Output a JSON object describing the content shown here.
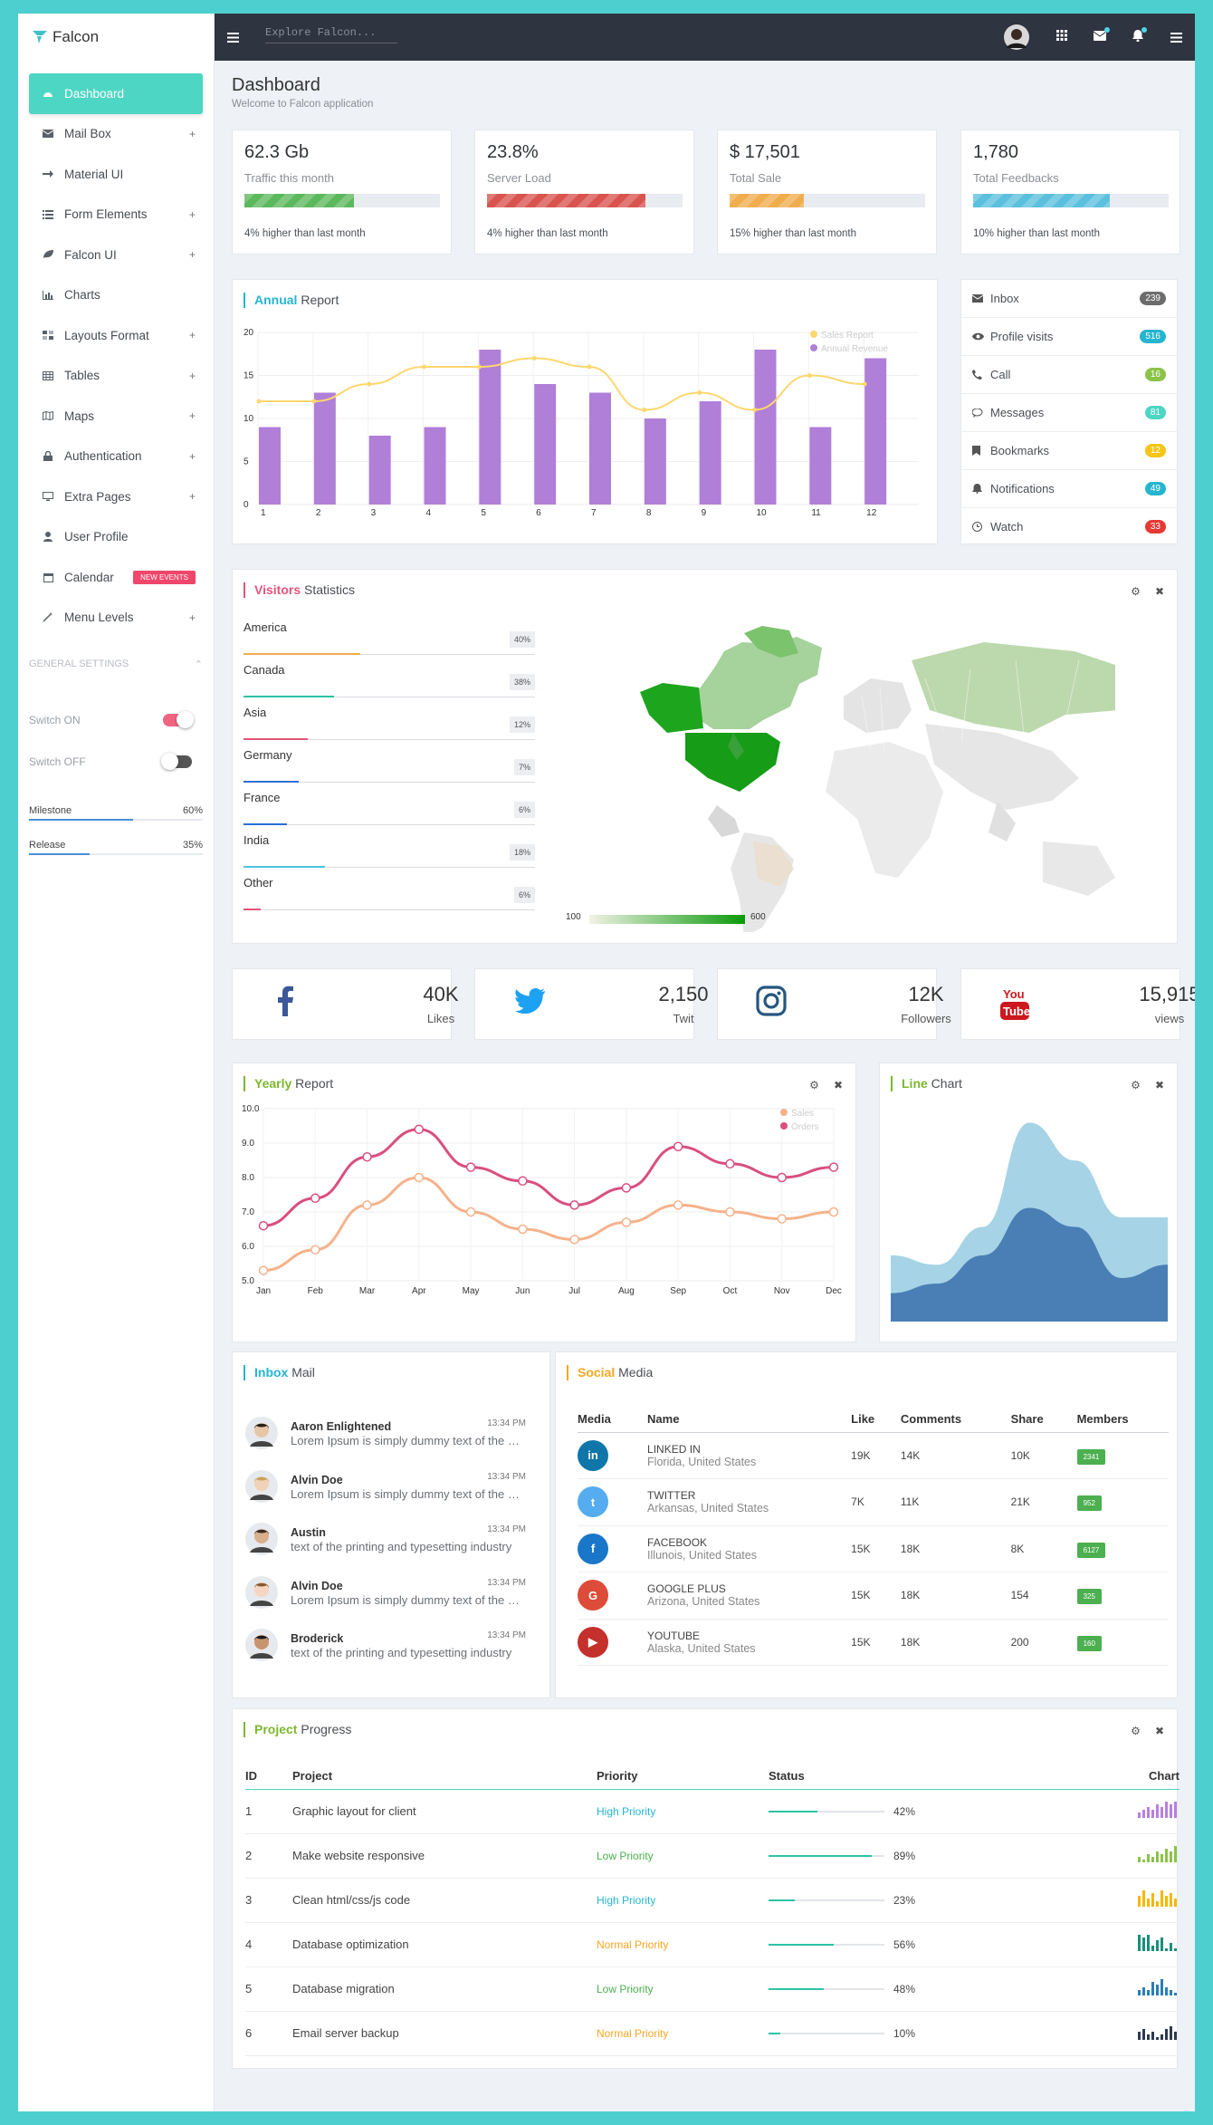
{
  "app": {
    "name": "Falcon"
  },
  "sidebar": {
    "items": [
      {
        "label": "Dashboard",
        "icon": "dashboard-icon",
        "plus": false,
        "active": true
      },
      {
        "label": "Mail Box",
        "icon": "envelope-icon",
        "plus": true
      },
      {
        "label": "Material UI",
        "icon": "arrow-right-icon",
        "plus": false
      },
      {
        "label": "Form Elements",
        "icon": "list-icon",
        "plus": true
      },
      {
        "label": "Falcon UI",
        "icon": "leaf-icon",
        "plus": true
      },
      {
        "label": "Charts",
        "icon": "bar-chart-icon",
        "plus": false
      },
      {
        "label": "Layouts Format",
        "icon": "layout-icon",
        "plus": true
      },
      {
        "label": "Tables",
        "icon": "table-icon",
        "plus": true
      },
      {
        "label": "Maps",
        "icon": "map-icon",
        "plus": true
      },
      {
        "label": "Authentication",
        "icon": "lock-icon",
        "plus": true
      },
      {
        "label": "Extra Pages",
        "icon": "monitor-icon",
        "plus": true
      },
      {
        "label": "User Profile",
        "icon": "user-icon",
        "plus": false
      },
      {
        "label": "Calendar",
        "icon": "calendar-icon",
        "plus": false,
        "badge": "NEW EVENTS"
      },
      {
        "label": "Menu Levels",
        "icon": "magic-icon",
        "plus": true
      }
    ],
    "general_settings": "GENERAL SETTINGS",
    "switch_on": "Switch ON",
    "switch_off": "Switch OFF",
    "milestone": {
      "label": "Milestone",
      "value": "60%",
      "fraction": 0.6
    },
    "release": {
      "label": "Release",
      "value": "35%",
      "fraction": 0.35
    }
  },
  "topbar": {
    "search_placeholder": "Explore Falcon..."
  },
  "page": {
    "title": "Dashboard",
    "subtitle": "Welcome to Falcon application"
  },
  "stats": [
    {
      "value": "62.3 Gb",
      "label": "Traffic this month",
      "note": "4% higher than last month",
      "fraction": 0.56,
      "color": "#5cb85c"
    },
    {
      "value": "23.8%",
      "label": "Server Load",
      "note": "4% higher than last month",
      "fraction": 0.81,
      "color": "#d9534f"
    },
    {
      "value": "$ 17,501",
      "label": "Total Sale",
      "note": "15% higher than last month",
      "fraction": 0.38,
      "color": "#f0ad4e"
    },
    {
      "value": "1,780",
      "label": "Total Feedbacks",
      "note": "10% higher than last month",
      "fraction": 0.7,
      "color": "#5bc0de"
    }
  ],
  "annual": {
    "title_strong": "Annual",
    "title_rest": " Report"
  },
  "inbox_list": [
    {
      "label": "Inbox",
      "icon": "envelope-icon",
      "count": "239",
      "color": "#6c6c6c"
    },
    {
      "label": "Profile visits",
      "icon": "eye-icon",
      "count": "516",
      "color": "#26b5cf"
    },
    {
      "label": "Call",
      "icon": "phone-icon",
      "count": "16",
      "color": "#8bc34a"
    },
    {
      "label": "Messages",
      "icon": "comments-icon",
      "count": "81",
      "color": "#4ed6c4"
    },
    {
      "label": "Bookmarks",
      "icon": "bookmark-icon",
      "count": "12",
      "color": "#f5c518"
    },
    {
      "label": "Notifications",
      "icon": "bell-icon",
      "count": "49",
      "color": "#26b5cf"
    },
    {
      "label": "Watch",
      "icon": "clock-icon",
      "count": "33",
      "color": "#e53935"
    }
  ],
  "visitors": {
    "title_strong": "Visitors",
    "title_rest": " Statistics",
    "rows": [
      {
        "country": "America",
        "value": "40%",
        "fraction": 0.4,
        "color": "#f0ad4e"
      },
      {
        "country": "Canada",
        "value": "38%",
        "fraction": 0.31,
        "color": "#2cc3a6"
      },
      {
        "country": "Asia",
        "value": "12%",
        "fraction": 0.22,
        "color": "#e5547a"
      },
      {
        "country": "Germany",
        "value": "7%",
        "fraction": 0.19,
        "color": "#2a6fd6"
      },
      {
        "country": "France",
        "value": "6%",
        "fraction": 0.15,
        "color": "#2a6fd6"
      },
      {
        "country": "India",
        "value": "18%",
        "fraction": 0.28,
        "color": "#4ec3e0"
      },
      {
        "country": "Other",
        "value": "6%",
        "fraction": 0.06,
        "color": "#e5547a"
      }
    ],
    "scale_min": "100",
    "scale_max": "600"
  },
  "social": [
    {
      "icon": "facebook-icon",
      "value": "40K",
      "label": "Likes"
    },
    {
      "icon": "twitter-icon",
      "value": "2,150",
      "label": "Twit"
    },
    {
      "icon": "instagram-icon",
      "value": "12K",
      "label": "Followers"
    },
    {
      "icon": "youtube-icon",
      "value": "15,915",
      "label": "views"
    }
  ],
  "yearly": {
    "title_strong": "Yearly",
    "title_rest": " Report"
  },
  "linechart": {
    "title_strong": "Line",
    "title_rest": " Chart"
  },
  "chart_data": [
    {
      "type": "bar",
      "categories": [
        "1",
        "2",
        "3",
        "4",
        "5",
        "6",
        "7",
        "8",
        "9",
        "10",
        "11",
        "12"
      ],
      "ylim": [
        0,
        20
      ],
      "yticks": [
        0,
        5,
        10,
        15,
        20
      ],
      "legend_position": "top-right",
      "series": [
        {
          "name": "Sales Report",
          "type": "line",
          "color": "#fcd76f",
          "values": [
            12,
            12,
            14,
            16,
            16,
            17,
            16,
            11,
            13,
            11,
            15,
            14
          ]
        },
        {
          "name": "Annual Revenue",
          "type": "bar",
          "color": "#b07fd8",
          "values": [
            9,
            13,
            8,
            9,
            18,
            14,
            13,
            10,
            12,
            18,
            9,
            17
          ]
        }
      ]
    },
    {
      "type": "line",
      "categories": [
        "Jan",
        "Feb",
        "Mar",
        "Apr",
        "May",
        "Jun",
        "Jul",
        "Aug",
        "Sep",
        "Oct",
        "Nov",
        "Dec"
      ],
      "ylim": [
        5,
        10
      ],
      "yticks": [
        "5.0",
        "6.0",
        "7.0",
        "8.0",
        "9.0",
        "10.0"
      ],
      "legend_position": "top-right",
      "series": [
        {
          "name": "Sales",
          "color": "#f5b28a",
          "values": [
            5.3,
            5.9,
            7.2,
            8.0,
            7.0,
            6.5,
            6.2,
            6.7,
            7.2,
            7.0,
            6.8,
            7.0
          ]
        },
        {
          "name": "Orders",
          "color": "#d94f7f",
          "values": [
            6.6,
            7.4,
            8.6,
            9.4,
            8.3,
            7.9,
            7.2,
            7.7,
            8.9,
            8.4,
            8.0,
            8.3
          ]
        }
      ]
    },
    {
      "type": "area",
      "x": [
        0,
        1,
        2,
        3,
        4,
        5,
        6
      ],
      "series": [
        {
          "color": "#a6d4e6",
          "values": [
            3.5,
            3.0,
            5.0,
            10.5,
            8.5,
            5.5,
            5.5
          ]
        },
        {
          "color": "#4a7fb5",
          "values": [
            1.5,
            2.0,
            3.5,
            6.0,
            5.0,
            2.3,
            3.0
          ]
        }
      ]
    }
  ],
  "inbox_mail": {
    "title_strong": "Inbox",
    "title_rest": " Mail",
    "items": [
      {
        "name": "Aaron Enlightened",
        "time": "13:34 PM",
        "text": "Lorem Ipsum is simply dummy text of the printing"
      },
      {
        "name": "Alvin Doe",
        "time": "13:34 PM",
        "text": "Lorem Ipsum is simply dummy text of the printing"
      },
      {
        "name": "Austin",
        "time": "13:34 PM",
        "text": "text of the printing and typesetting industry"
      },
      {
        "name": "Alvin Doe",
        "time": "13:34 PM",
        "text": "Lorem Ipsum is simply dummy text of the printing"
      },
      {
        "name": "Broderick",
        "time": "13:34 PM",
        "text": "text of the printing and typesetting industry"
      }
    ]
  },
  "social_media": {
    "title_strong": "Social",
    "title_rest": " Media",
    "headers": [
      "Media",
      "Name",
      "Like",
      "Comments",
      "Share",
      "Members"
    ],
    "rows": [
      {
        "icon": "linkedin-icon",
        "glyph": "in",
        "color": "#0e76a8",
        "name": "LINKED IN",
        "location": "Florida, United States",
        "like": "19K",
        "comments": "14K",
        "share": "10K",
        "members": "2341"
      },
      {
        "icon": "twitter-icon",
        "glyph": "t",
        "color": "#55acee",
        "name": "TWITTER",
        "location": "Arkansas, United States",
        "like": "7K",
        "comments": "11K",
        "share": "21K",
        "members": "952"
      },
      {
        "icon": "facebook-icon",
        "glyph": "f",
        "color": "#1976c8",
        "name": "FACEBOOK",
        "location": "Illunois, United States",
        "like": "15K",
        "comments": "18K",
        "share": "8K",
        "members": "6127"
      },
      {
        "icon": "google-plus-icon",
        "glyph": "G",
        "color": "#dd4b39",
        "name": "GOOGLE PLUS",
        "location": "Arizona, United States",
        "like": "15K",
        "comments": "18K",
        "share": "154",
        "members": "325"
      },
      {
        "icon": "youtube-icon",
        "glyph": "▶",
        "color": "#c4302b",
        "name": "YOUTUBE",
        "location": "Alaska, United States",
        "like": "15K",
        "comments": "18K",
        "share": "200",
        "members": "160"
      }
    ]
  },
  "project": {
    "title_strong": "Project",
    "title_rest": " Progress",
    "headers": [
      "ID",
      "Project",
      "Priority",
      "Status",
      "Chart"
    ],
    "rows": [
      {
        "id": "1",
        "name": "Graphic layout for client",
        "priority": "High Priority",
        "pcolor": "#26b5cf",
        "status": "42%",
        "fraction": 0.42,
        "ccolor": "#b77fe0",
        "spark": [
          2,
          3,
          4,
          3,
          5,
          4,
          6,
          5,
          7
        ]
      },
      {
        "id": "2",
        "name": "Make website responsive",
        "priority": "Low Priority",
        "pcolor": "#4caf50",
        "status": "89%",
        "fraction": 0.89,
        "ccolor": "#8bc34a",
        "spark": [
          2,
          1,
          3,
          2,
          4,
          3,
          5,
          4,
          6
        ]
      },
      {
        "id": "3",
        "name": "Clean html/css/js code",
        "priority": "High Priority",
        "pcolor": "#26b5cf",
        "status": "23%",
        "fraction": 0.23,
        "ccolor": "#f5b800",
        "spark": [
          4,
          6,
          3,
          5,
          2,
          6,
          4,
          5,
          3
        ]
      },
      {
        "id": "4",
        "name": "Database optimization",
        "priority": "Normal Priority",
        "pcolor": "#f5a623",
        "status": "56%",
        "fraction": 0.56,
        "ccolor": "#1a8f7a",
        "spark": [
          6,
          5,
          6,
          2,
          4,
          5,
          1,
          3,
          1
        ]
      },
      {
        "id": "5",
        "name": "Database migration",
        "priority": "Low Priority",
        "pcolor": "#4caf50",
        "status": "48%",
        "fraction": 0.48,
        "ccolor": "#2a7fb8",
        "spark": [
          2,
          3,
          2,
          5,
          4,
          6,
          3,
          2,
          1
        ]
      },
      {
        "id": "6",
        "name": "Email server backup",
        "priority": "Normal Priority",
        "pcolor": "#f5a623",
        "status": "10%",
        "fraction": 0.1,
        "ccolor": "#2e3a4e",
        "spark": [
          3,
          4,
          2,
          3,
          1,
          2,
          4,
          5,
          3
        ]
      }
    ]
  }
}
